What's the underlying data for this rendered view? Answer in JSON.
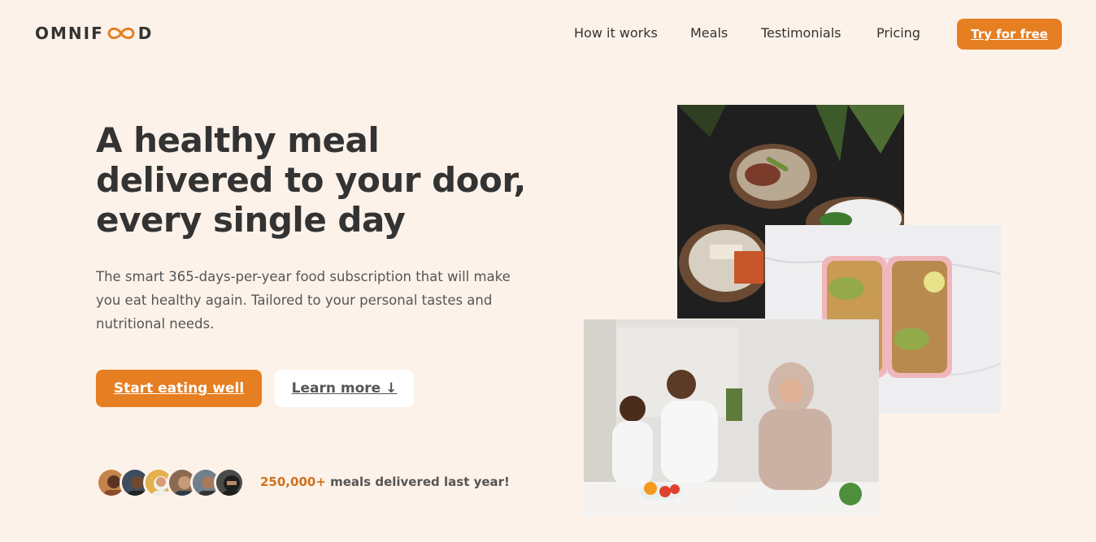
{
  "header": {
    "logo_left": "OMNIF",
    "logo_right": "D",
    "nav": [
      {
        "label": "How it works"
      },
      {
        "label": "Meals"
      },
      {
        "label": "Testimonials"
      },
      {
        "label": "Pricing"
      }
    ],
    "cta_label": "Try for free"
  },
  "hero": {
    "title": "A healthy meal delivered to your door, every single day",
    "description": "The smart 365-days-per-year food subscription that will make you eat healthy again. Tailored to your personal tastes and nutritional needs.",
    "primary_button": "Start eating well",
    "secondary_button": "Learn more ↓",
    "delivered_count": "250,000+",
    "delivered_text": " meals delivered last year!"
  },
  "colors": {
    "accent": "#e67e22",
    "background": "#fdf2e9",
    "text": "#333333"
  },
  "icons": {
    "logo_mark": "infinity-icon"
  }
}
